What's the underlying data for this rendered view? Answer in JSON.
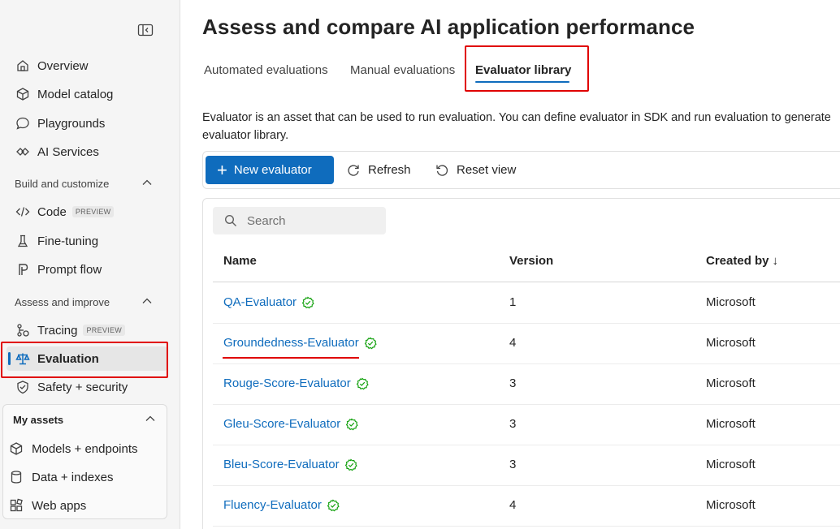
{
  "sidebar": {
    "nav": [
      {
        "label": "Overview",
        "icon": "home-icon"
      },
      {
        "label": "Model catalog",
        "icon": "cube-icon"
      },
      {
        "label": "Playgrounds",
        "icon": "chat-icon"
      },
      {
        "label": "AI Services",
        "icon": "ai-services-icon"
      }
    ],
    "build_section": {
      "title": "Build and customize",
      "items": [
        {
          "label": "Code",
          "badge": "PREVIEW"
        },
        {
          "label": "Fine-tuning"
        },
        {
          "label": "Prompt flow"
        }
      ]
    },
    "assess_section": {
      "title": "Assess and improve",
      "items": [
        {
          "label": "Tracing",
          "badge": "PREVIEW"
        },
        {
          "label": "Evaluation"
        },
        {
          "label": "Safety + security"
        }
      ]
    },
    "assets_section": {
      "title": "My assets",
      "items": [
        {
          "label": "Models + endpoints"
        },
        {
          "label": "Data + indexes"
        },
        {
          "label": "Web apps"
        }
      ]
    }
  },
  "main": {
    "title": "Assess and compare AI application performance",
    "tabs": [
      {
        "label": "Automated evaluations"
      },
      {
        "label": "Manual evaluations"
      },
      {
        "label": "Evaluator library"
      }
    ],
    "description_line1": "Evaluator is an asset that can be used to run evaluation. You can define evaluator in SDK and run evaluation to generate",
    "description_line2": "evaluator library.",
    "toolbar": {
      "new_label": "New evaluator",
      "refresh_label": "Refresh",
      "reset_label": "Reset view"
    },
    "search": {
      "placeholder": "Search"
    },
    "table": {
      "columns": [
        "Name",
        "Version",
        "Created by"
      ],
      "sort_arrow": "↓",
      "rows": [
        {
          "name": "QA-Evaluator",
          "version": "1",
          "created_by": "Microsoft"
        },
        {
          "name": "Groundedness-Evaluator",
          "version": "4",
          "created_by": "Microsoft"
        },
        {
          "name": "Rouge-Score-Evaluator",
          "version": "3",
          "created_by": "Microsoft"
        },
        {
          "name": "Gleu-Score-Evaluator",
          "version": "3",
          "created_by": "Microsoft"
        },
        {
          "name": "Bleu-Score-Evaluator",
          "version": "3",
          "created_by": "Microsoft"
        },
        {
          "name": "Fluency-Evaluator",
          "version": "4",
          "created_by": "Microsoft"
        }
      ]
    }
  },
  "colors": {
    "accent": "#0f6cbd",
    "highlight": "#e00000",
    "verified": "#13a10e"
  }
}
